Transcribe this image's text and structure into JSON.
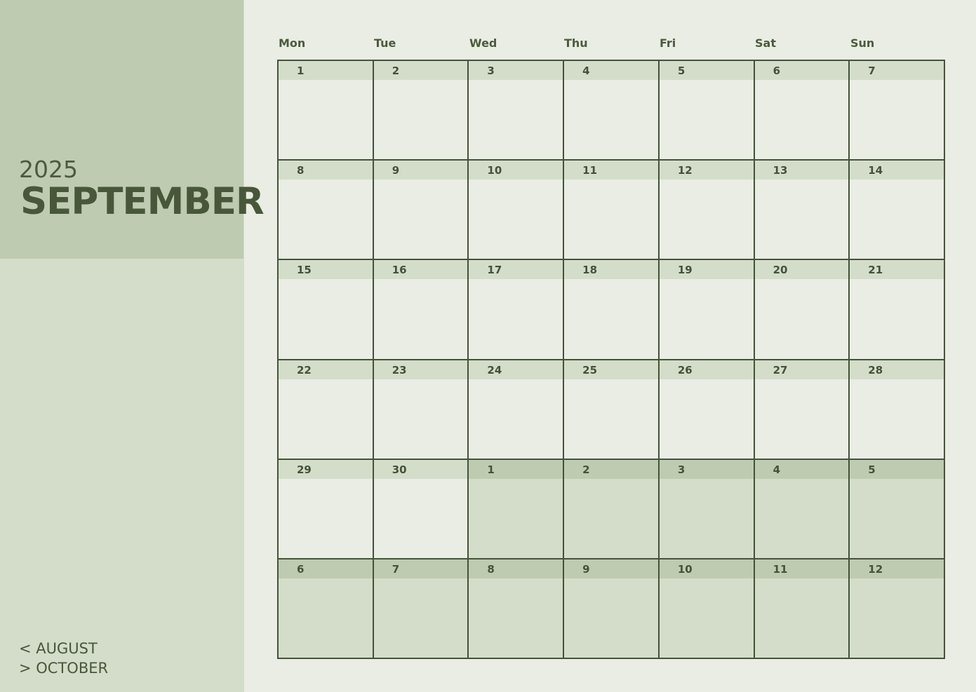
{
  "calendar": {
    "year": "2025",
    "month": "SEPTEMBER",
    "prev_label": "< AUGUST",
    "next_label": "> OCTOBER",
    "weekdays": [
      "Mon",
      "Tue",
      "Wed",
      "Thu",
      "Fri",
      "Sat",
      "Sun"
    ],
    "days": [
      {
        "label": "1",
        "current": true
      },
      {
        "label": "2",
        "current": true
      },
      {
        "label": "3",
        "current": true
      },
      {
        "label": "4",
        "current": true
      },
      {
        "label": "5",
        "current": true
      },
      {
        "label": "6",
        "current": true
      },
      {
        "label": "7",
        "current": true
      },
      {
        "label": "8",
        "current": true
      },
      {
        "label": "9",
        "current": true
      },
      {
        "label": "10",
        "current": true
      },
      {
        "label": "11",
        "current": true
      },
      {
        "label": "12",
        "current": true
      },
      {
        "label": "13",
        "current": true
      },
      {
        "label": "14",
        "current": true
      },
      {
        "label": "15",
        "current": true
      },
      {
        "label": "16",
        "current": true
      },
      {
        "label": "17",
        "current": true
      },
      {
        "label": "18",
        "current": true
      },
      {
        "label": "19",
        "current": true
      },
      {
        "label": "20",
        "current": true
      },
      {
        "label": "21",
        "current": true
      },
      {
        "label": "22",
        "current": true
      },
      {
        "label": "23",
        "current": true
      },
      {
        "label": "24",
        "current": true
      },
      {
        "label": "25",
        "current": true
      },
      {
        "label": "26",
        "current": true
      },
      {
        "label": "27",
        "current": true
      },
      {
        "label": "28",
        "current": true
      },
      {
        "label": "29",
        "current": true
      },
      {
        "label": "30",
        "current": true
      },
      {
        "label": "1",
        "current": false
      },
      {
        "label": "2",
        "current": false
      },
      {
        "label": "3",
        "current": false
      },
      {
        "label": "4",
        "current": false
      },
      {
        "label": "5",
        "current": false
      },
      {
        "label": "6",
        "current": false
      },
      {
        "label": "7",
        "current": false
      },
      {
        "label": "8",
        "current": false
      },
      {
        "label": "9",
        "current": false
      },
      {
        "label": "10",
        "current": false
      },
      {
        "label": "11",
        "current": false
      },
      {
        "label": "12",
        "current": false
      }
    ]
  },
  "colors": {
    "page_background": "#eaede4",
    "sidebar": "#d4ddca",
    "sidebar_header": "#bfcbb1",
    "text": "#48573a",
    "grid_line": "#44523a"
  }
}
